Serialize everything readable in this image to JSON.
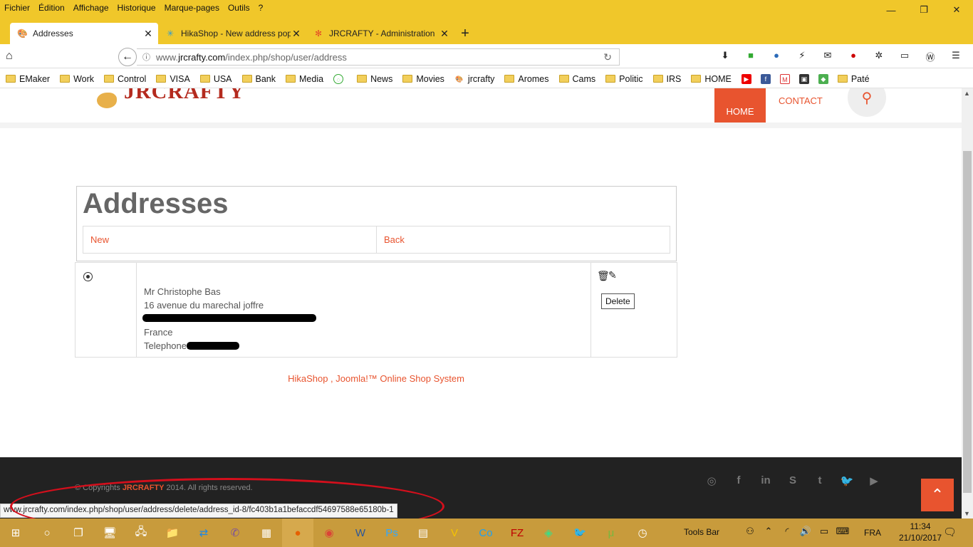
{
  "menu": [
    "Fichier",
    "Édition",
    "Affichage",
    "Historique",
    "Marque-pages",
    "Outils",
    "?"
  ],
  "window": {
    "minimize": "—",
    "restore": "❐",
    "close": "✕"
  },
  "tabs": [
    {
      "label": "Addresses",
      "icon": "palette-icon"
    },
    {
      "label": "HikaShop - New address pop",
      "icon": "hikashop-icon"
    },
    {
      "label": "JRCRAFTY - Administration",
      "icon": "joomla-icon"
    }
  ],
  "tab_close": "✕",
  "new_tab": "+",
  "url": {
    "prefix": "www.",
    "domain": "jrcrafty.com",
    "path": "/index.php/shop/user/address"
  },
  "bookmarks": [
    "EMaker",
    "Work",
    "Control",
    "VISA",
    "USA",
    "Bank",
    "Media",
    "News",
    "Movies",
    "jrcrafty",
    "Aromes",
    "Cams",
    "Politic",
    "IRS",
    "HOME",
    "Paté"
  ],
  "site": {
    "logo": "JRCRAFTY",
    "nav": {
      "home": "HOME",
      "contact": "CONTACT"
    },
    "page_title": "Addresses",
    "actions": {
      "new": "New",
      "back": "Back"
    },
    "address": {
      "name": "Mr Christophe Bas",
      "street": "16 avenue du marechal joffre",
      "country": "France",
      "phone_label": "Telephone:"
    },
    "tooltip": "Delete",
    "credit": "HikaShop , Joomla!™ Online Shop System",
    "footer": {
      "prefix": "© Copyrights",
      "brand": "JRCRAFTY",
      "suffix": "2014. All rights reserved."
    },
    "social": [
      "dribbble",
      "facebook",
      "linkedin",
      "skype",
      "tumblr",
      "twitter",
      "youtube"
    ]
  },
  "status_url": "www.jrcrafty.com/index.php/shop/user/address/delete/address_id-8/fc403b1a1befaccdf54697588e65180b-1",
  "taskbar": {
    "tools_bar": "Tools Bar",
    "lang": "FRA",
    "time": "11:34",
    "date": "21/10/2017"
  },
  "colors": {
    "firefox_chrome": "#f0c72a",
    "accent": "#e8542f",
    "taskbar": "#c89b3c",
    "footer": "#222222",
    "annotation": "#d40f1c"
  }
}
